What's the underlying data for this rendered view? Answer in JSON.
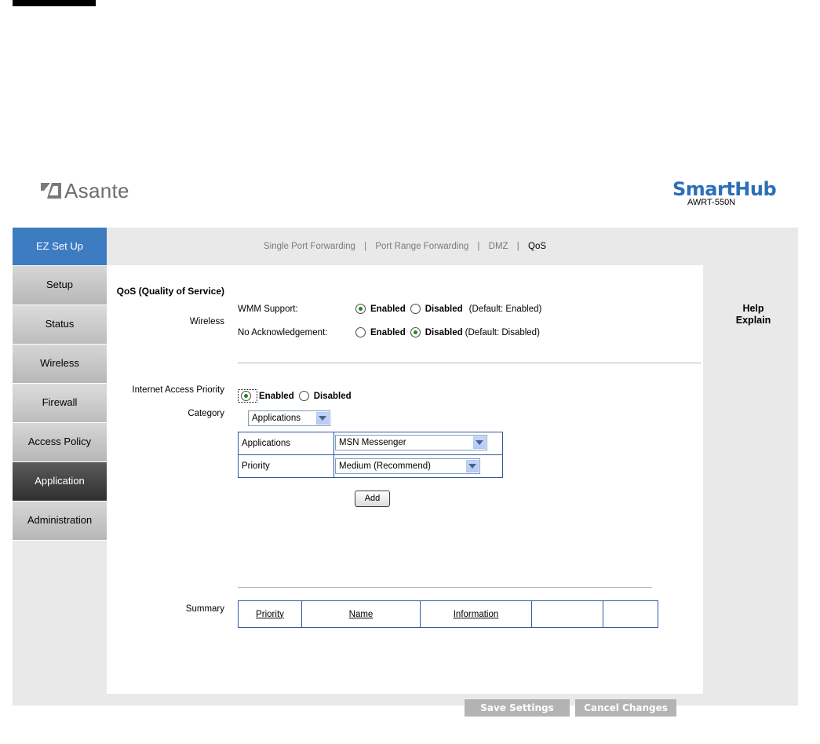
{
  "header": {
    "logo_text": "Asante",
    "brand_name": "SmartHub",
    "model": "AWRT-550N"
  },
  "sidebar": {
    "items": [
      {
        "label": "EZ Set Up"
      },
      {
        "label": "Setup"
      },
      {
        "label": "Status"
      },
      {
        "label": "Wireless"
      },
      {
        "label": "Firewall"
      },
      {
        "label": "Access Policy"
      },
      {
        "label": "Application"
      },
      {
        "label": "Administration"
      }
    ],
    "active": "Application"
  },
  "tabs": {
    "items": [
      "Single Port Forwarding",
      "Port Range Forwarding",
      "DMZ",
      "QoS"
    ],
    "separator": "|",
    "current": "QoS"
  },
  "qos": {
    "section_title": "QoS (Quality of Service)",
    "wireless_label": "Wireless",
    "wmm": {
      "label": "WMM Support:",
      "enabled_label": "Enabled",
      "disabled_label": "Disabled",
      "default_note": "(Default: Enabled)",
      "selected": "Enabled"
    },
    "no_ack": {
      "label": "No Acknowledgement:",
      "enabled_label": "Enabled",
      "disabled_label": "Disabled",
      "default_note": "(Default: Disabled)",
      "selected": "Disabled"
    }
  },
  "internet_access": {
    "label": "Internet Access Priority",
    "enabled_label": "Enabled",
    "disabled_label": "Disabled",
    "selected": "Enabled",
    "category_label": "Category",
    "category_value": "Applications",
    "applications_label": "Applications",
    "applications_value": "MSN Messenger",
    "priority_label": "Priority",
    "priority_value": "Medium (Recommend)",
    "add_label": "Add"
  },
  "summary": {
    "label": "Summary",
    "columns": [
      "Priority",
      "Name",
      "Information",
      "",
      ""
    ]
  },
  "help": {
    "line1": "Help",
    "line2": "Explain"
  },
  "actions": {
    "save": "Save Settings",
    "cancel": "Cancel Changes"
  },
  "colors": {
    "ez_setup_bg": "#3e7cc2",
    "brand_blue": "#2d6fb7",
    "active_nav_bg": "#3a3a3a",
    "radio_dot": "#1d8a1d",
    "table_border": "#2f5aa0"
  }
}
